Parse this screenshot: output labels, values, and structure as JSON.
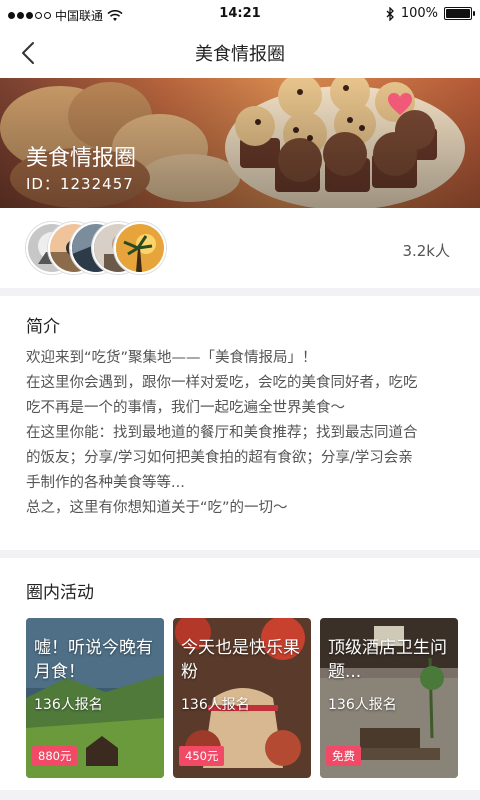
{
  "status_bar": {
    "carrier": "中国联通",
    "time": "14:21",
    "battery": "100%"
  },
  "nav": {
    "title": "美食情报圈",
    "back_icon": "chevron-left-icon"
  },
  "banner": {
    "title": "美食情报圈",
    "id_text": "ID：1232457",
    "favorite_icon": "heart-icon",
    "favorite_color": "#f05a78"
  },
  "members": {
    "count": "3.2k人"
  },
  "intro": {
    "title": "简介",
    "lines": [
      "欢迎来到“吃货”聚集地——「美食情报局」！",
      "在这里你会遇到，跟你一样对爱吃，会吃的美食同好者，吃吃",
      "吃不再是一个的事情，我们一起吃遍全世界美食～",
      "在这里你能：找到最地道的餐厅和美食推荐；找到最志同道合",
      "的饭友；分享/学习如何把美食拍的超有食欲；分享/学习会亲",
      "手制作的各种美食等等...",
      "总之，这里有你想知道关于“吃”的一切～"
    ]
  },
  "activities": {
    "title": "圈内活动",
    "cards": [
      {
        "title": "嘘！听说今晚有月食！",
        "signups": "136人报名",
        "price": "880元"
      },
      {
        "title": "今天也是快乐果粉",
        "signups": "136人报名",
        "price": "450元"
      },
      {
        "title": "顶级酒店卫生问题...",
        "signups": "136人报名",
        "price": "免费"
      }
    ]
  },
  "colors": {
    "accent": "#f04a66",
    "background": "#f2f2f4"
  }
}
